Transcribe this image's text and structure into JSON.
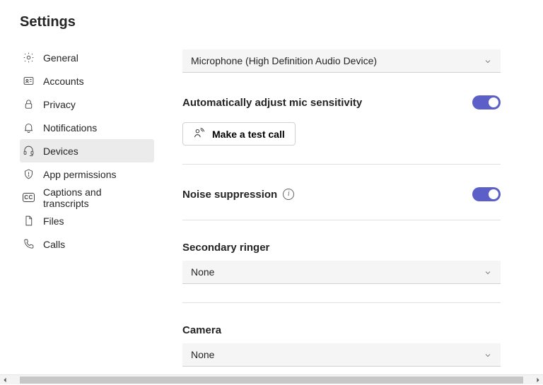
{
  "title": "Settings",
  "sidebar": {
    "items": [
      {
        "label": "General"
      },
      {
        "label": "Accounts"
      },
      {
        "label": "Privacy"
      },
      {
        "label": "Notifications"
      },
      {
        "label": "Devices"
      },
      {
        "label": "App permissions"
      },
      {
        "label": "Captions and transcripts"
      },
      {
        "label": "Files"
      },
      {
        "label": "Calls"
      }
    ]
  },
  "main": {
    "microphone_select": "Microphone (High Definition Audio Device)",
    "auto_adjust_label": "Automatically adjust mic sensitivity",
    "auto_adjust_on": true,
    "test_call_label": "Make a test call",
    "noise_suppression_label": "Noise suppression",
    "noise_suppression_on": true,
    "secondary_ringer_heading": "Secondary ringer",
    "secondary_ringer_value": "None",
    "camera_heading": "Camera",
    "camera_value": "None"
  },
  "colors": {
    "accent": "#5b5fc7"
  }
}
